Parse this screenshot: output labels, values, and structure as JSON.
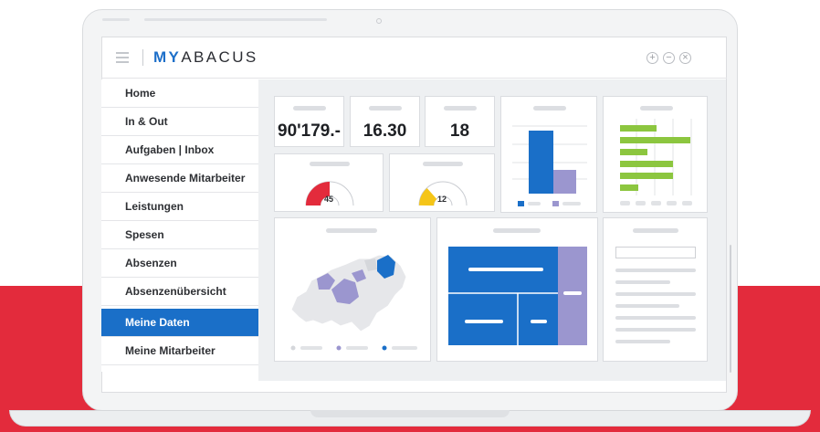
{
  "app": {
    "logo_prefix": "MY",
    "logo_suffix": "ABACUS"
  },
  "window_controls": [
    {
      "name": "zoom-in",
      "glyph": "+"
    },
    {
      "name": "zoom-out",
      "glyph": "−"
    },
    {
      "name": "close",
      "glyph": "×"
    }
  ],
  "sidebar": {
    "items": [
      {
        "label": "Home"
      },
      {
        "label": "In & Out"
      },
      {
        "label": "Aufgaben | Inbox"
      },
      {
        "label": "Anwesende Mitarbeiter"
      },
      {
        "label": "Leistungen"
      },
      {
        "label": "Spesen"
      },
      {
        "label": "Absenzen"
      },
      {
        "label": "Absenzenübersicht"
      },
      {
        "label": "Meine Daten"
      },
      {
        "label": "Meine Mitarbeiter"
      }
    ],
    "active_index": 8
  },
  "kpis": [
    {
      "value": "90'179.-"
    },
    {
      "value": "16.30"
    },
    {
      "value": "18"
    }
  ],
  "gauges": [
    {
      "value": "45",
      "fill_fraction": 0.45,
      "color": "#e32b3c"
    },
    {
      "value": "12",
      "fill_fraction": 0.35,
      "color": "#f5c518"
    }
  ],
  "colors": {
    "accent": "#1a6fc8",
    "brand_red": "#e32b3c",
    "lavender": "#9b96cf",
    "green": "#8cc63f",
    "yellow": "#f5c518"
  }
}
